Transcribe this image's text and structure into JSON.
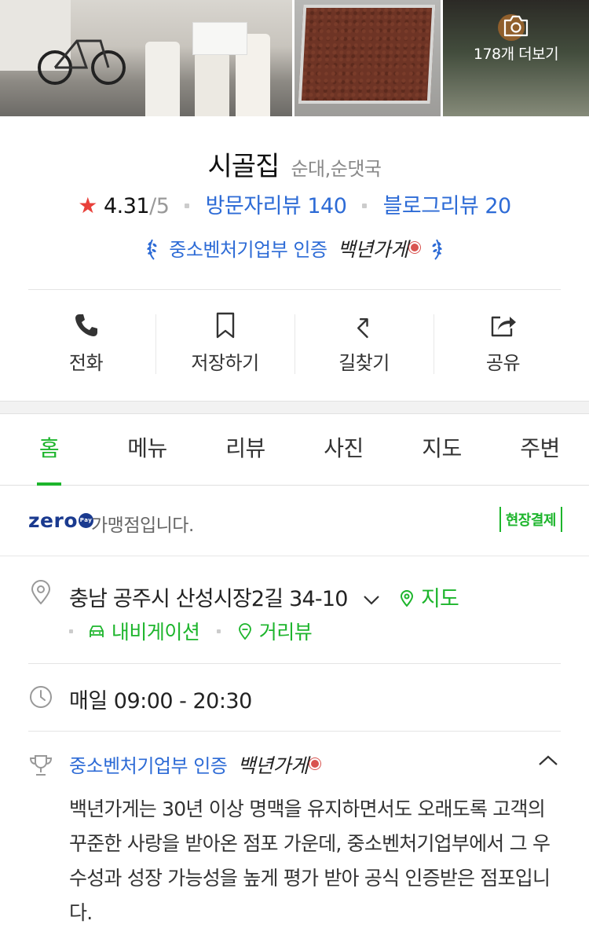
{
  "photos": {
    "more_label": "178개 더보기",
    "camera_icon": "camera-icon"
  },
  "place": {
    "name": "시골집",
    "category": "순대,순댓국",
    "rating": "4.31",
    "rating_max": "/5",
    "visitor_reviews": "방문자리뷰 140",
    "blog_reviews": "블로그리뷰 20",
    "certification": "중소벤처기업부 인증",
    "cert_script": "백년가게"
  },
  "actions": [
    {
      "label": "전화",
      "icon": "phone-icon"
    },
    {
      "label": "저장하기",
      "icon": "bookmark-icon"
    },
    {
      "label": "길찾기",
      "icon": "directions-icon"
    },
    {
      "label": "공유",
      "icon": "share-icon"
    }
  ],
  "tabs": [
    {
      "label": "홈",
      "active": true
    },
    {
      "label": "메뉴"
    },
    {
      "label": "리뷰"
    },
    {
      "label": "사진"
    },
    {
      "label": "지도"
    },
    {
      "label": "주변"
    }
  ],
  "zeropay": {
    "logo": "zero",
    "pay_mark": "Pay",
    "text": "가맹점입니다.",
    "onsite_badge": "현장결제"
  },
  "details": {
    "address": "충남 공주시 산성시장2길 34-10",
    "map_link": "지도",
    "navigation_link": "내비게이션",
    "streetview_link": "거리뷰",
    "hours": "매일 09:00 - 20:30",
    "cert_title": "중소벤처기업부 인증",
    "cert_script": "백년가게",
    "cert_description": "백년가게는 30년 이상 명맥을 유지하면서도 오래도록 고객의 꾸준한 사랑을 받아온 점포 가운데, 중소벤처기업부에서 그 우수성과 성장 가능성을 높게 평가 받아 공식 인증받은 점포입니다."
  },
  "colors": {
    "accent_green": "#1db52c",
    "link_blue": "#2d6bd6",
    "star_red": "#e8403a",
    "zeropay_navy": "#1a3a8f"
  }
}
